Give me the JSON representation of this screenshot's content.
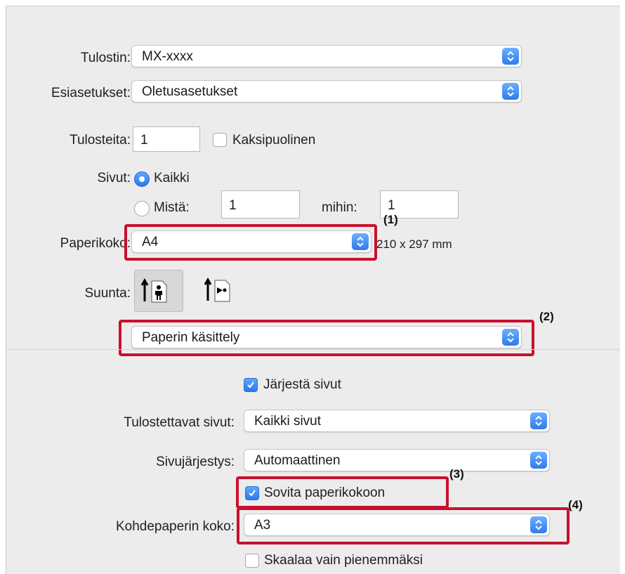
{
  "printer": {
    "label": "Tulostin:",
    "value": "MX-xxxx"
  },
  "presets": {
    "label": "Esiasetukset:",
    "value": "Oletusasetukset"
  },
  "copies": {
    "label": "Tulosteita:",
    "value": "1",
    "duplex_label": "Kaksipuolinen",
    "duplex_checked": false
  },
  "pages": {
    "label": "Sivut:",
    "all_label": "Kaikki",
    "from_label": "Mistä:",
    "from_value": "1",
    "to_label": "mihin:",
    "to_value": "1",
    "selected": "all"
  },
  "paper_size": {
    "label": "Paperikoko:",
    "value": "A4",
    "dims": "210 x 297 mm"
  },
  "orientation": {
    "label": "Suunta:",
    "options": [
      "portrait",
      "landscape"
    ],
    "selected": "portrait"
  },
  "section_menu": {
    "value": "Paperin käsittely"
  },
  "collate": {
    "label": "Järjestä sivut",
    "checked": true
  },
  "pages_to_print": {
    "label": "Tulostettavat sivut:",
    "value": "Kaikki sivut"
  },
  "page_order": {
    "label": "Sivujärjestys:",
    "value": "Automaattinen"
  },
  "scale_to_fit": {
    "label": "Sovita paperikokoon",
    "checked": true
  },
  "dest_paper": {
    "label": "Kohdepaperin koko:",
    "value": "A3"
  },
  "scale_down_only": {
    "label": "Skaalaa vain pienemmäksi",
    "checked": false
  },
  "callouts": {
    "c1": "(1)",
    "c2": "(2)",
    "c3": "(3)",
    "c4": "(4)"
  },
  "colors": {
    "accent": "#2f7bea",
    "highlight": "#c8102e",
    "panel": "#ececec"
  }
}
